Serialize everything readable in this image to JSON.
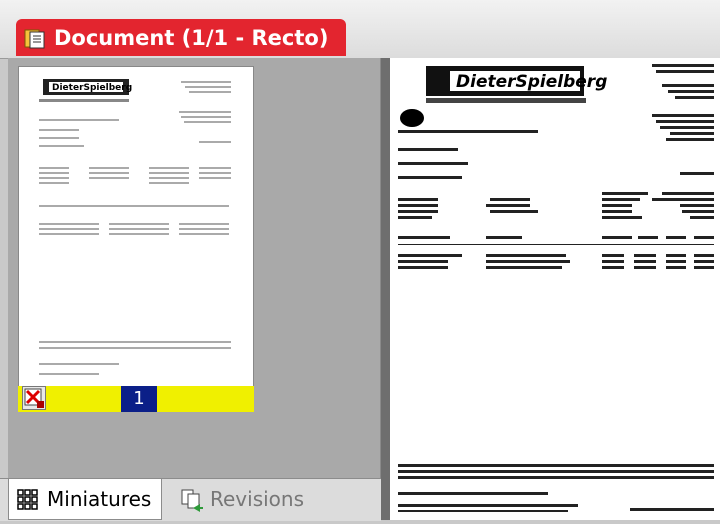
{
  "window": {
    "document_tab_title": "Document (1/1 - Recto)"
  },
  "thumbnails": [
    {
      "page_number": "1"
    }
  ],
  "bottom_tabs": [
    {
      "label": "Miniatures"
    },
    {
      "label": "Revisions"
    }
  ],
  "page_preview": {
    "logo_text": "DieterSpielberg"
  },
  "colors": {
    "tab_red": "#e3252f",
    "thumb_bar_yellow": "#f0f000",
    "page_number_blue": "#0b1f88"
  }
}
